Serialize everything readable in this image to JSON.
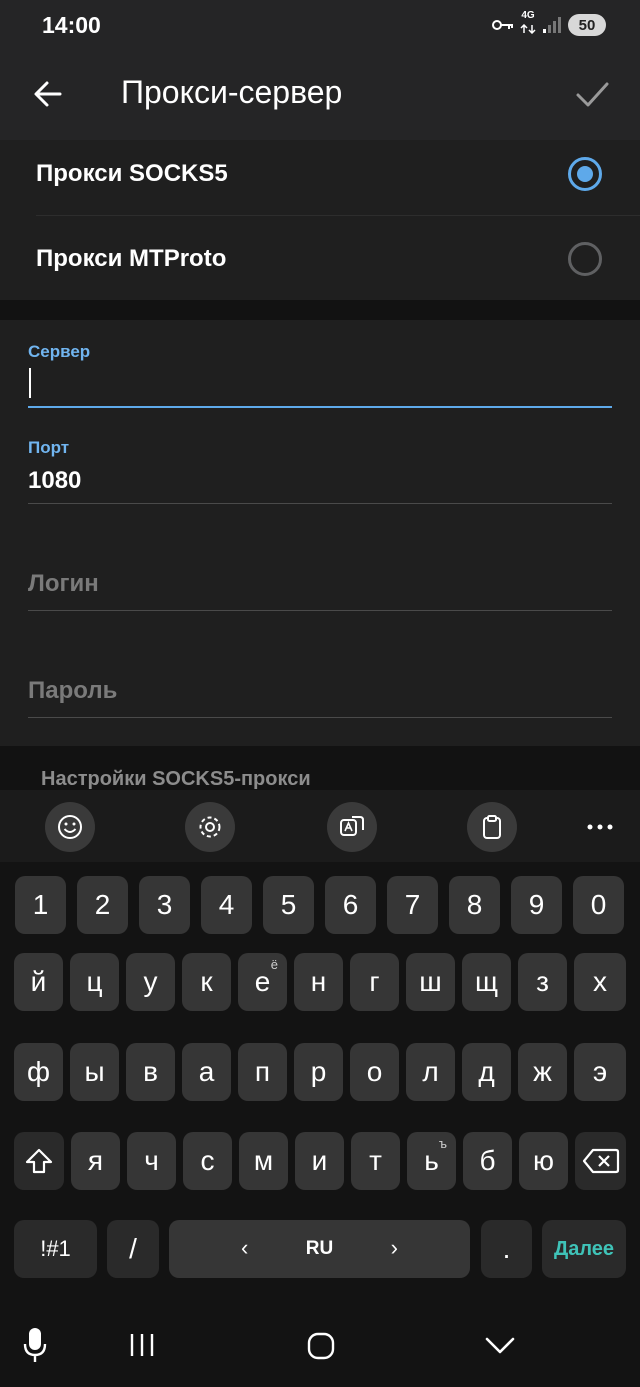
{
  "status_bar": {
    "time": "14:00",
    "network": "4G",
    "battery": "50"
  },
  "app_bar": {
    "title": "Прокси-сервер",
    "back_icon": "arrow-left-icon",
    "confirm_icon": "check-icon"
  },
  "proxy_types": [
    {
      "label": "Прокси SOCKS5",
      "selected": true
    },
    {
      "label": "Прокси MTProto",
      "selected": false
    }
  ],
  "form": {
    "server": {
      "label": "Сервер",
      "value": ""
    },
    "port": {
      "label": "Порт",
      "value": "1080"
    },
    "login": {
      "placeholder": "Логин"
    },
    "password": {
      "placeholder": "Пароль"
    }
  },
  "section_header": "Настройки SOCKS5-прокси",
  "keyboard": {
    "toolbar": [
      "emoji-icon",
      "settings-icon",
      "translate-icon",
      "clipboard-icon",
      "more-icon"
    ],
    "rows": [
      [
        "1",
        "2",
        "3",
        "4",
        "5",
        "6",
        "7",
        "8",
        "9",
        "0"
      ],
      [
        "й",
        "ц",
        "у",
        "к",
        "е",
        "н",
        "г",
        "ш",
        "щ",
        "з",
        "х"
      ],
      [
        "ф",
        "ы",
        "в",
        "а",
        "п",
        "р",
        "о",
        "л",
        "д",
        "ж",
        "э"
      ],
      [
        "я",
        "ч",
        "с",
        "м",
        "и",
        "т",
        "ь",
        "б",
        "ю"
      ]
    ],
    "superscripts": {
      "е": "ё",
      "ь": "ъ"
    },
    "symbols_label": "!#1",
    "slash": "/",
    "language": "RU",
    "period": ".",
    "next_label": "Далее",
    "accent_color": "#3fc3b8"
  },
  "colors": {
    "accent": "#5ea9ea",
    "label": "#71b5f0"
  }
}
